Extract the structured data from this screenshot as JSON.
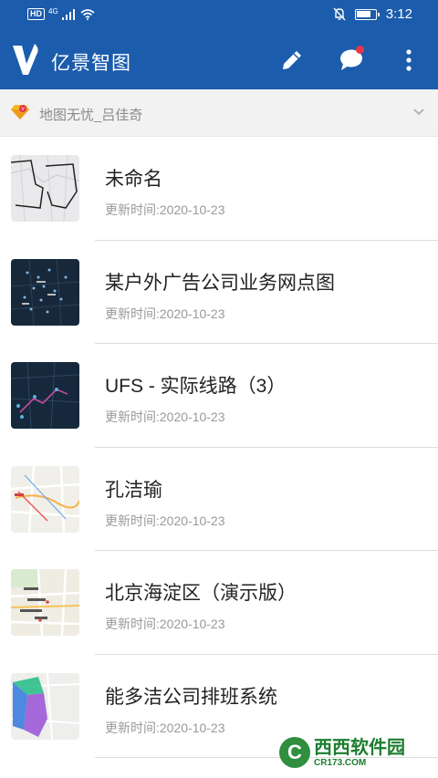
{
  "status_bar": {
    "hd": "HD",
    "network": "4G",
    "time": "3:12",
    "battery_level": 0.8
  },
  "app_bar": {
    "title": "亿景智图",
    "icons": [
      "logo-icon",
      "edit-icon",
      "chat-icon",
      "more-icon"
    ],
    "accent_color": "#1c5cac"
  },
  "account": {
    "name": "地图无忧_吕佳奇"
  },
  "maps": [
    {
      "name": "未命名",
      "updated": "更新时间:2020-10-23"
    },
    {
      "name": "某户外广告公司业务网点图",
      "updated": "更新时间:2020-10-23"
    },
    {
      "name": "UFS - 实际线路（3）",
      "updated": "更新时间:2020-10-23"
    },
    {
      "name": "孔洁瑜",
      "updated": "更新时间:2020-10-23"
    },
    {
      "name": "北京海淀区（演示版）",
      "updated": "更新时间:2020-10-23"
    },
    {
      "name": "能多洁公司排班系统",
      "updated": "更新时间:2020-10-23"
    }
  ],
  "watermark": {
    "brand": "西西",
    "tagline": "软件园",
    "url": "CR173.COM"
  }
}
